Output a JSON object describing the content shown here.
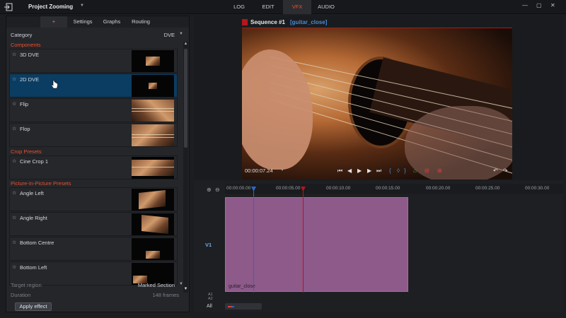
{
  "topbar": {
    "exit_icon": "exit-icon",
    "project_title": "Project Zooming",
    "tabs": [
      {
        "label": "LOG",
        "active": false
      },
      {
        "label": "EDIT",
        "active": false
      },
      {
        "label": "VFX",
        "active": true
      },
      {
        "label": "AUDIO",
        "active": false
      }
    ],
    "window_controls": [
      "minimize",
      "maximize",
      "close"
    ]
  },
  "left_panel": {
    "subtabs": [
      {
        "label": "+",
        "active": true
      },
      {
        "label": "Settings",
        "active": false
      },
      {
        "label": "Graphs",
        "active": false
      },
      {
        "label": "Routing",
        "active": false
      }
    ],
    "category_label": "Category",
    "category_value": "DVE",
    "sections": [
      {
        "header": "Components",
        "items": [
          {
            "name": "3D DVE",
            "selected": false
          },
          {
            "name": "2D DVE",
            "selected": true
          },
          {
            "name": "Flip",
            "selected": false
          },
          {
            "name": "Flop",
            "selected": false
          }
        ]
      },
      {
        "header": "Crop Presets",
        "items": [
          {
            "name": "Cine Crop 1",
            "selected": false
          }
        ]
      },
      {
        "header": "Picture-In-Picture Presets",
        "items": [
          {
            "name": "Angle Left",
            "selected": false
          },
          {
            "name": "Angle Right",
            "selected": false
          },
          {
            "name": "Bottom Centre",
            "selected": false
          },
          {
            "name": "Bottom Left",
            "selected": false
          }
        ]
      }
    ],
    "target_region_label": "Target region",
    "target_region_value": "Marked Section",
    "duration_label": "Duration",
    "duration_value": "148 frames",
    "apply_label": "Apply effect"
  },
  "viewer": {
    "sequence_title": "Sequence #1",
    "clip_label": "[guitar_close]",
    "timecode": "00:00:07.24"
  },
  "timeline": {
    "ruler_labels": [
      "00:00:00.00",
      "00:00:05.00",
      "00:00:10.00",
      "00:00:15.00",
      "00:00:20.00",
      "00:00:25.00",
      "00:00:30.00"
    ],
    "track_label": "V1",
    "audio_labels": [
      "A1",
      "A2"
    ],
    "all_label": "All",
    "clip_name": "guitar_close"
  },
  "colors": {
    "accent": "#e8502e",
    "selection": "#0b3d63",
    "clip": "#8d5a8a",
    "playhead_in": "#3064c9",
    "playhead_out": "#b3161b"
  }
}
